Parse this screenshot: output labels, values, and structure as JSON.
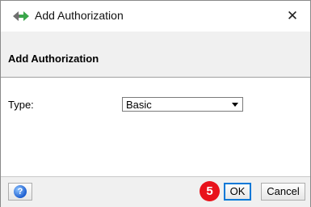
{
  "window": {
    "title": "Add Authorization",
    "app_icon": "diamond-arrows-icon",
    "close_icon": "close-icon",
    "close_glyph": "✕"
  },
  "header": {
    "title": "Add Authorization"
  },
  "form": {
    "type_label": "Type:",
    "type_value": "Basic"
  },
  "footer": {
    "help_icon": "help-icon",
    "help_glyph": "?",
    "step_badge": "5",
    "ok_label": "OK",
    "cancel_label": "Cancel"
  },
  "colors": {
    "accent": "#0078d7",
    "badge": "#e8121b",
    "icon_green": "#3aa64a",
    "icon_gray": "#6f6f6f"
  }
}
